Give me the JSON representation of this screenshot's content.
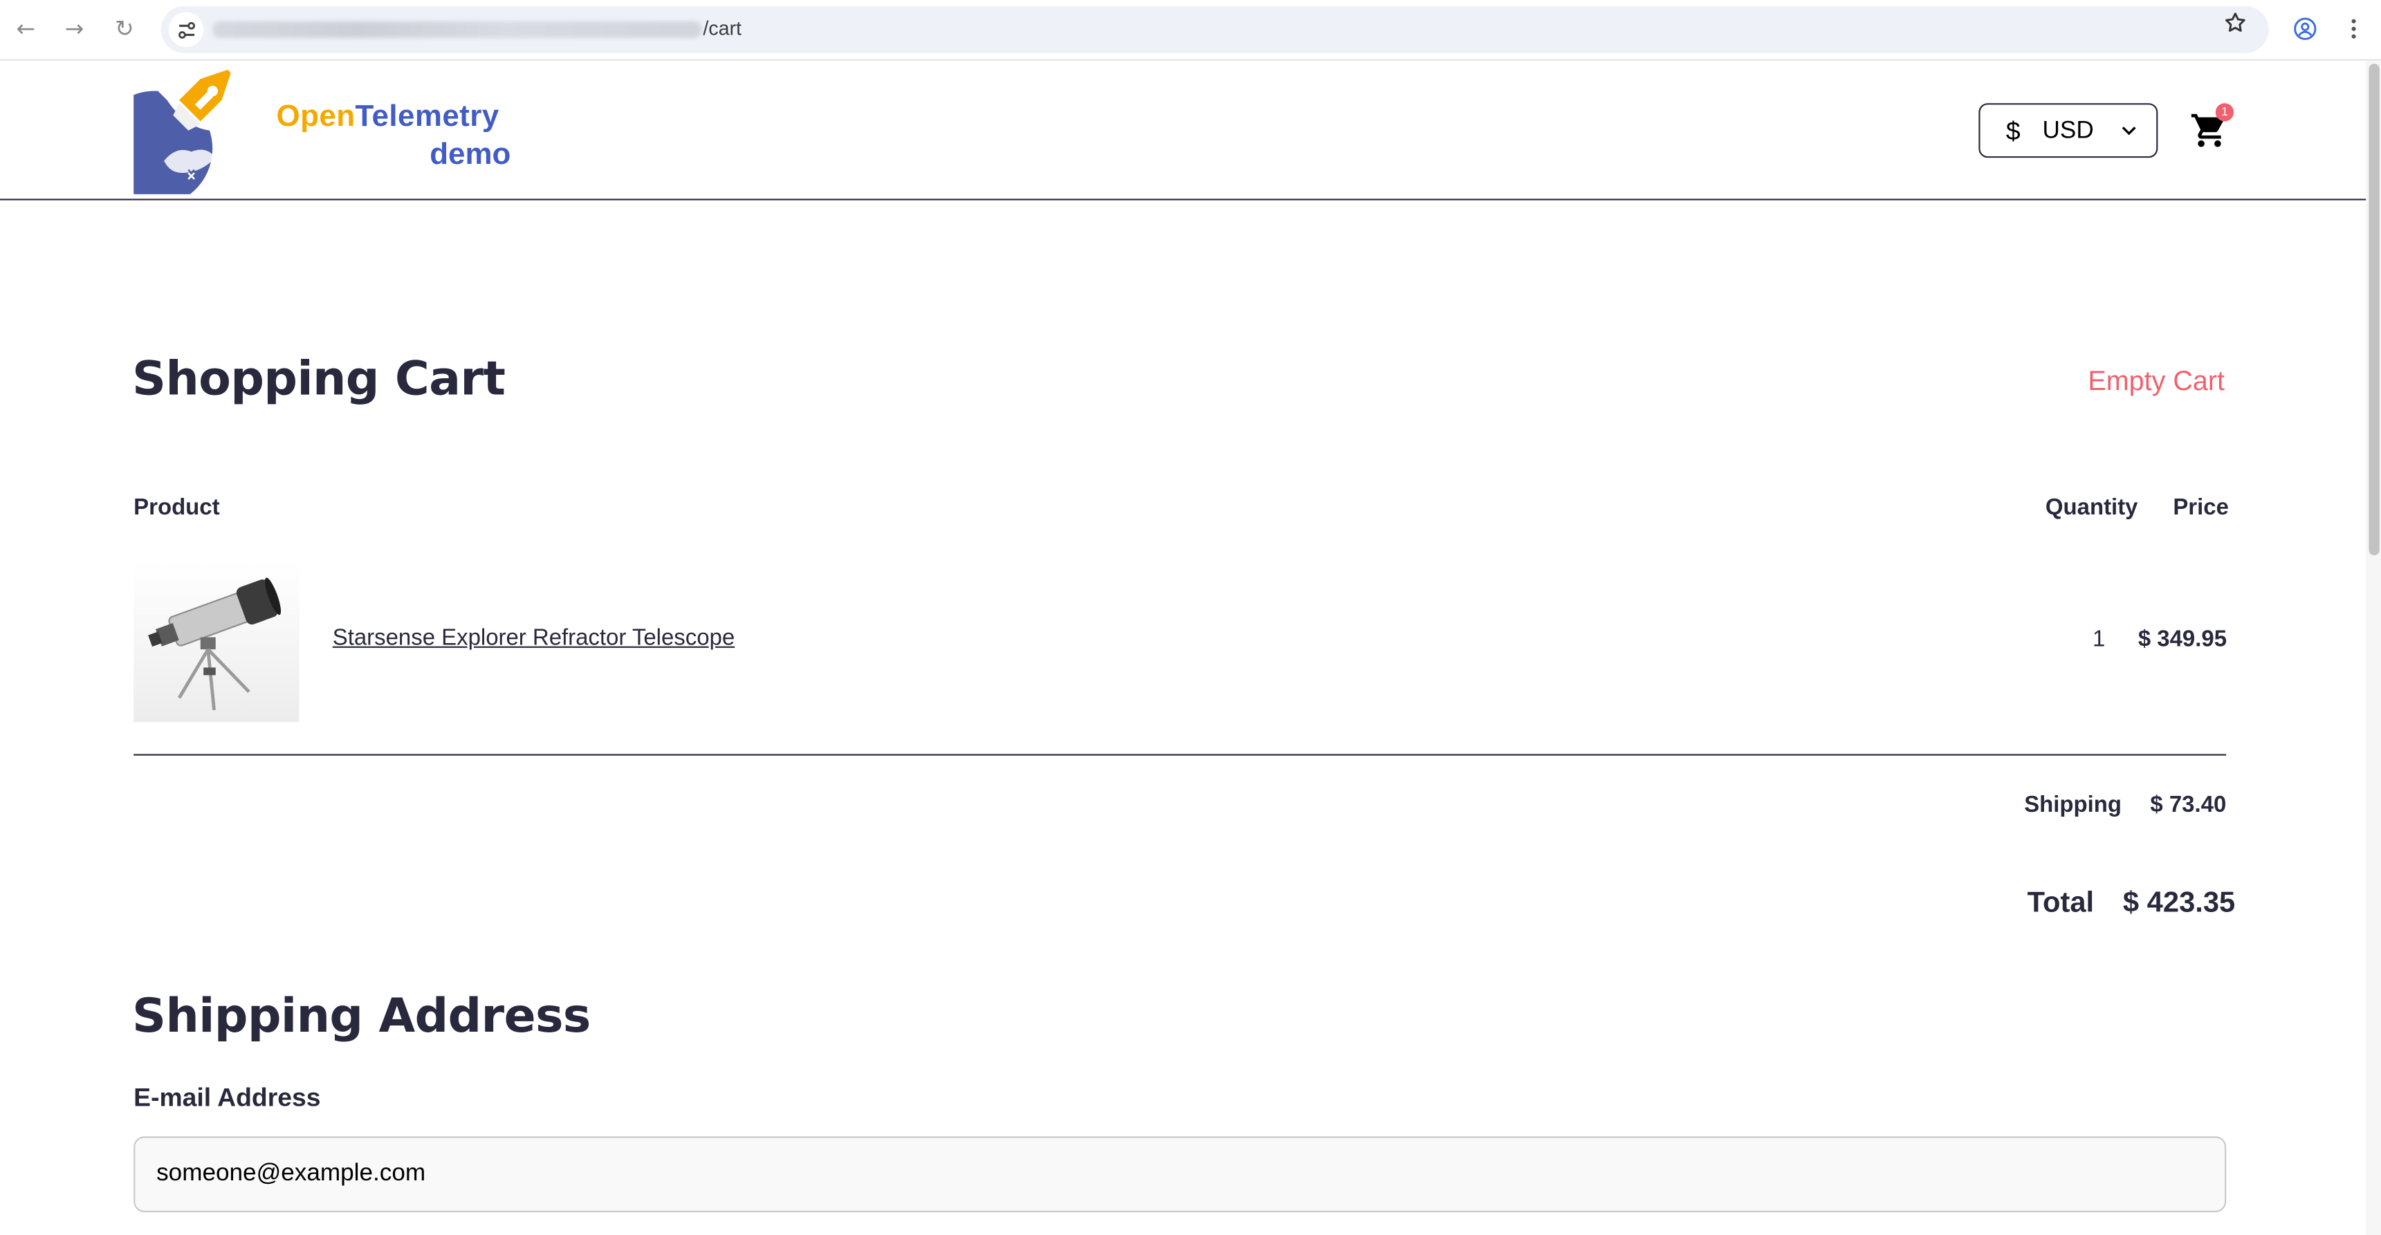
{
  "browser": {
    "url_path": "/cart",
    "back_label": "←",
    "forward_label": "→",
    "reload_label": "↻"
  },
  "header": {
    "brand_open": "Open",
    "brand_telemetry": "Telemetry",
    "brand_demo": "demo",
    "currency_symbol": "$",
    "currency_code": "USD",
    "cart_count": "1"
  },
  "cart": {
    "title": "Shopping Cart",
    "empty_cart_label": "Empty Cart",
    "columns": {
      "product": "Product",
      "quantity": "Quantity",
      "price": "Price"
    },
    "items": [
      {
        "name": "Starsense Explorer Refractor Telescope",
        "quantity": "1",
        "price": "$ 349.95"
      }
    ],
    "shipping_label": "Shipping",
    "shipping_value": "$ 73.40",
    "total_label": "Total",
    "total_value": "$ 423.35"
  },
  "shipping_address": {
    "title": "Shipping Address",
    "email_label": "E-mail Address",
    "email_value": "someone@example.com"
  },
  "colors": {
    "text": "#29293e",
    "brand_orange": "#f5a800",
    "brand_blue": "#425cc7",
    "danger": "#f0606e"
  }
}
